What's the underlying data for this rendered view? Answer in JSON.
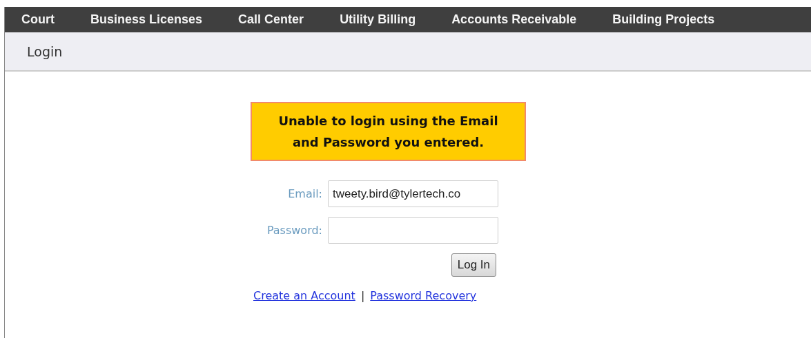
{
  "nav": {
    "items": [
      {
        "label": "Court"
      },
      {
        "label": "Business Licenses"
      },
      {
        "label": "Call Center"
      },
      {
        "label": "Utility Billing"
      },
      {
        "label": "Accounts Receivable"
      },
      {
        "label": "Building Projects"
      }
    ]
  },
  "page_title": "Login",
  "error_message": "Unable to login using the Email and Password you entered.",
  "form": {
    "fields": [
      {
        "label": "Email:",
        "value": "tweety.bird@tylertech.co"
      },
      {
        "label": "Password:"
      }
    ],
    "submit": "Log In",
    "links": [
      {
        "label": "Create an Account"
      },
      {
        "label": "Password Recovery"
      }
    ],
    "link_separator": "|"
  }
}
